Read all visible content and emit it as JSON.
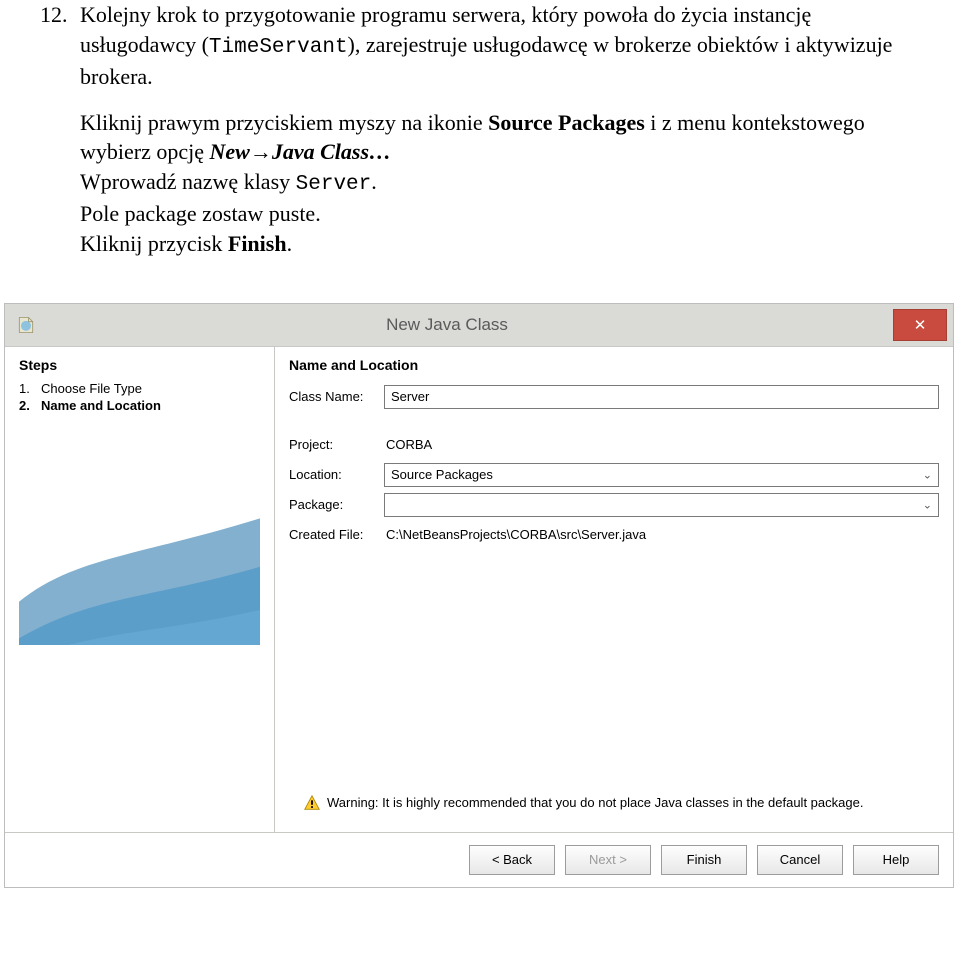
{
  "doc": {
    "list_number": "12.",
    "p1_a": "Kolejny krok to przygotowanie programu serwera, który powoła do życia instancję usługodawcy (",
    "p1_code": "TimeServant",
    "p1_b": "), zarejestruje usługodawcę w brokerze obiektów i aktywizuje brokera.",
    "p2_a": "Kliknij prawym przyciskiem myszy na ikonie ",
    "p2_b": "Source Packages",
    "p2_c": " i z menu kontekstowego wybierz opcję ",
    "p2_d1": "New",
    "p2_arrow": "→",
    "p2_d2": "Java Class…",
    "p3_a": "Wprowadź nazwę klasy ",
    "p3_code": "Server",
    "p3_b": ".",
    "p4": "Pole package zostaw puste.",
    "p5_a": "Kliknij przycisk ",
    "p5_b": "Finish",
    "p5_c": "."
  },
  "dialog": {
    "title": "New Java Class",
    "steps_header": "Steps",
    "step1_num": "1.",
    "step1_label": "Choose File Type",
    "step2_num": "2.",
    "step2_label": "Name and Location",
    "section_header": "Name and Location",
    "class_label": "Class Name:",
    "class_value": "Server",
    "project_label": "Project:",
    "project_value": "CORBA",
    "location_label": "Location:",
    "location_value": "Source Packages",
    "package_label": "Package:",
    "package_value": "",
    "created_label": "Created File:",
    "created_value": "C:\\NetBeansProjects\\CORBA\\src\\Server.java",
    "warning": "Warning: It is highly recommended that you do not place Java classes in the default package.",
    "btn_back": "< Back",
    "btn_next": "Next >",
    "btn_finish": "Finish",
    "btn_cancel": "Cancel",
    "btn_help": "Help"
  }
}
